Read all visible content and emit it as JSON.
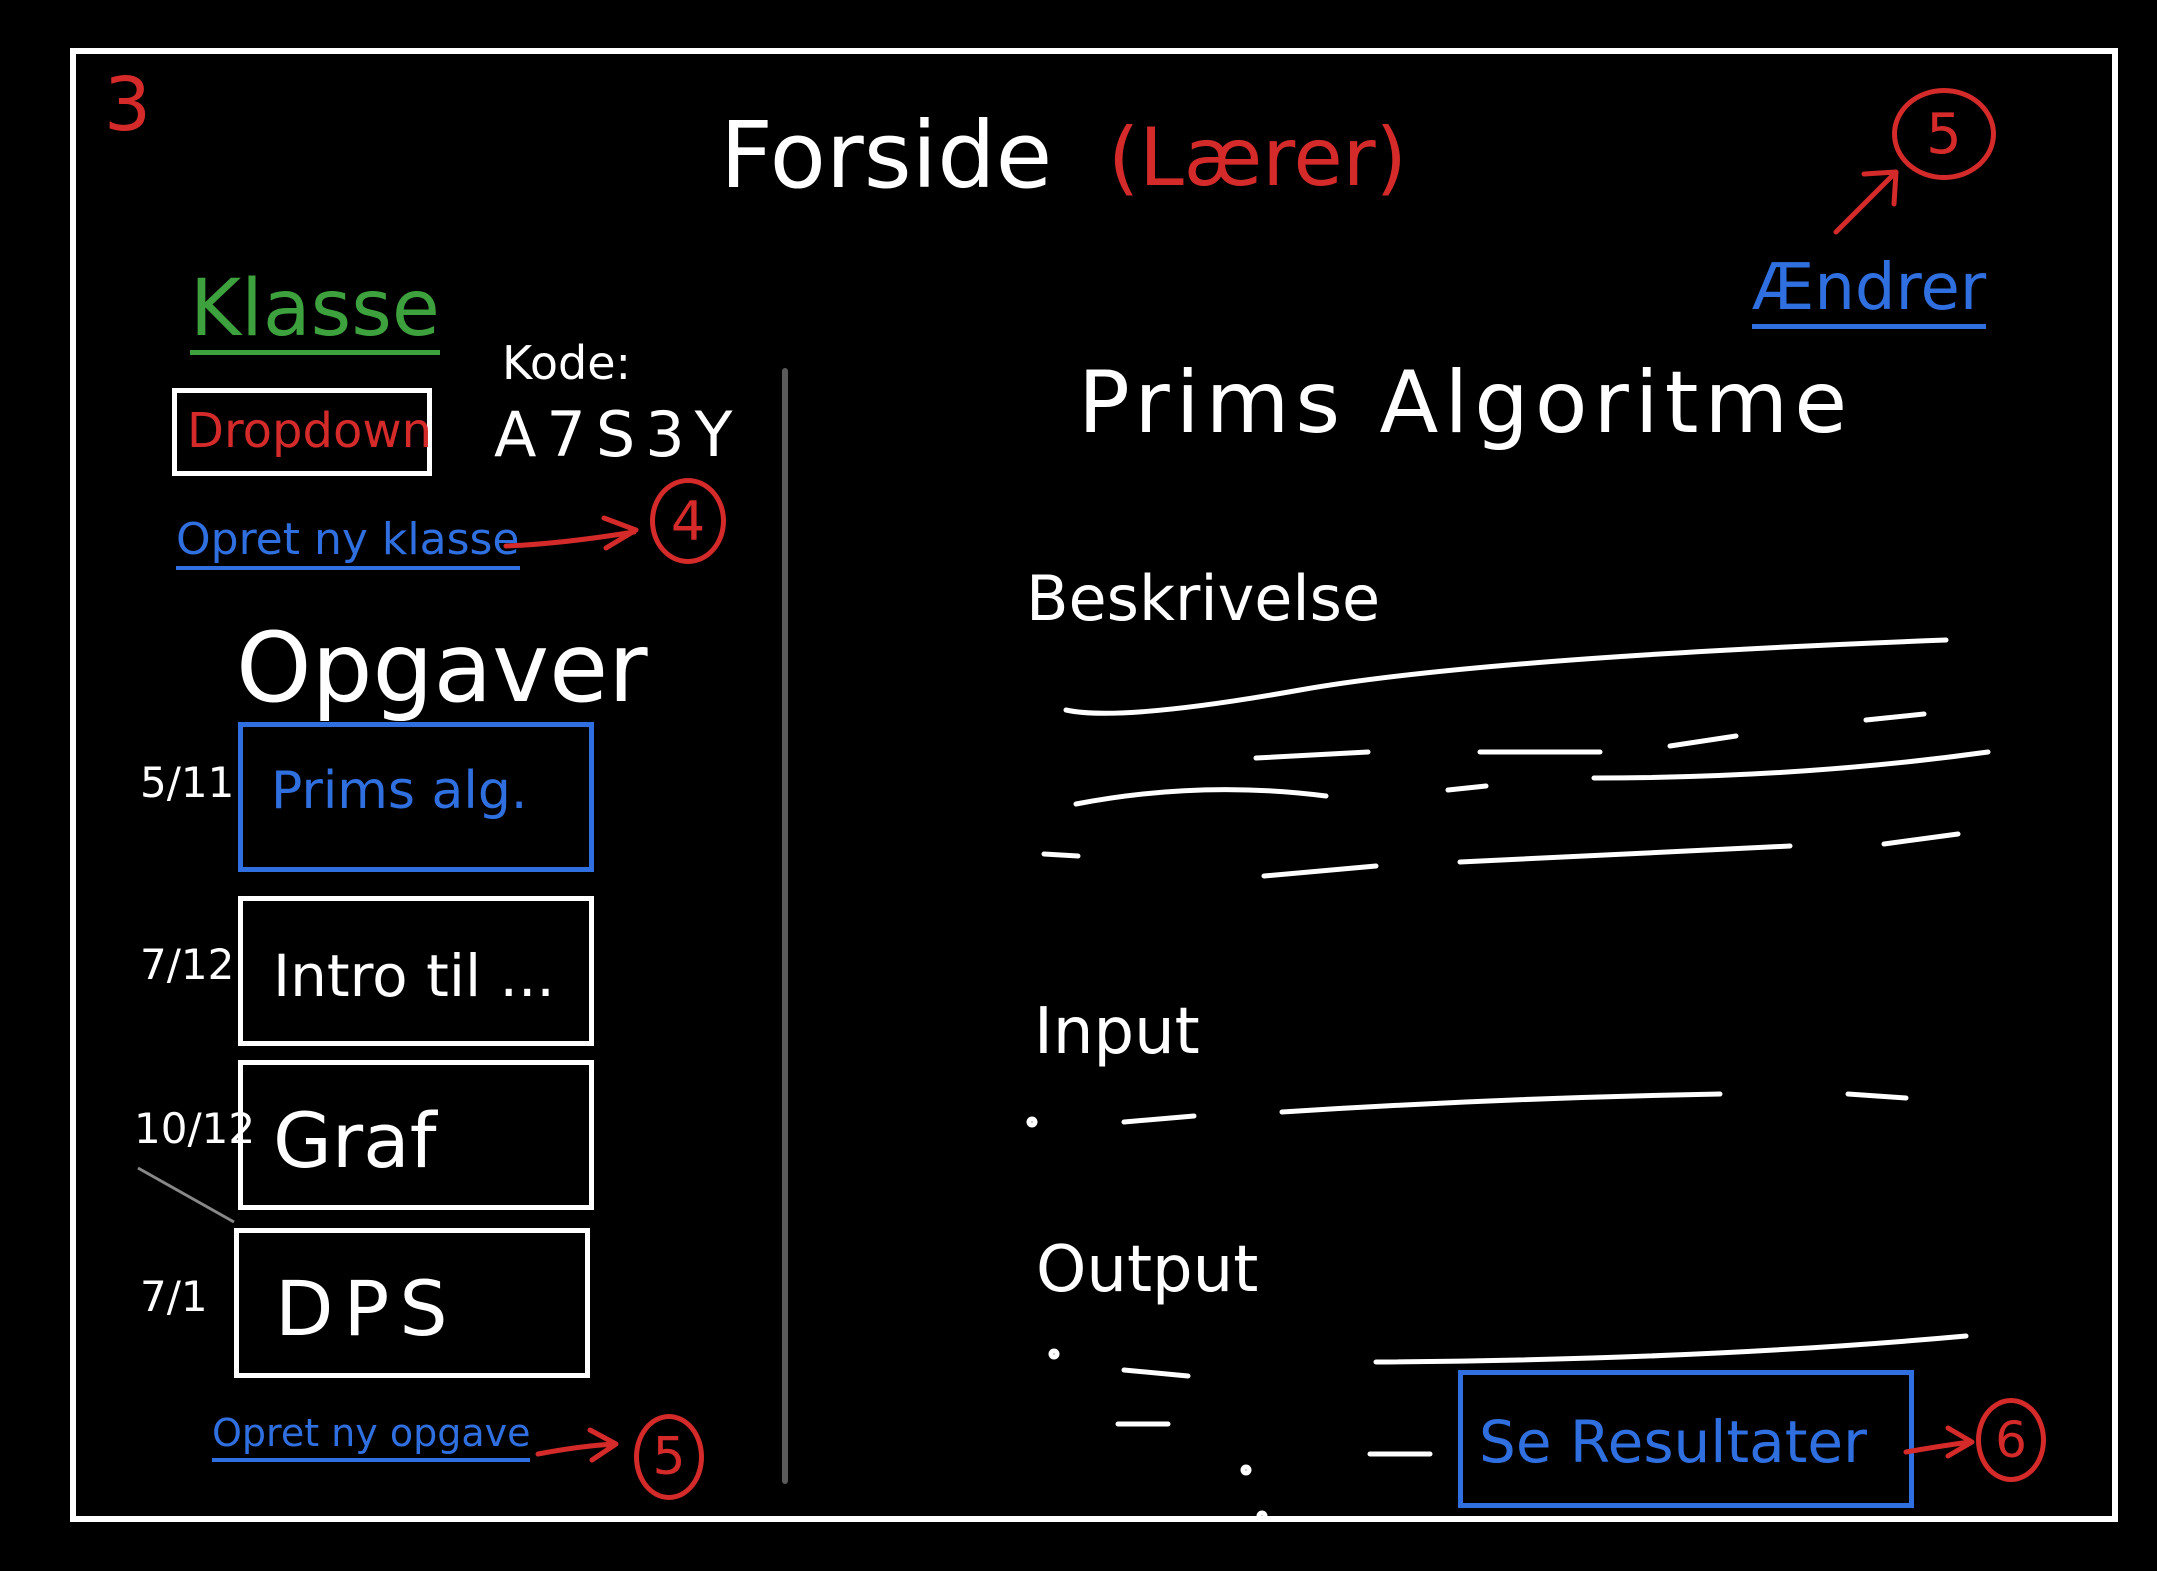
{
  "page_number": "3",
  "title": {
    "main": "Forside",
    "role": "(Lærer)"
  },
  "badges": {
    "edit": "5",
    "new_class": "4",
    "new_task": "5",
    "results": "6"
  },
  "left": {
    "class_label": "Klasse",
    "dropdown": "Dropdown",
    "code_label": "Kode:",
    "code_value": "A7S3Y",
    "new_class_link": "Opret ny klasse",
    "tasks_heading": "Opgaver",
    "tasks": [
      {
        "date": "5/11",
        "title": "Prims alg."
      },
      {
        "date": "7/12",
        "title": "Intro til ..."
      },
      {
        "date": "10/12",
        "title": "Graf"
      },
      {
        "date": "7/1",
        "title": "DPS"
      }
    ],
    "new_task_link": "Opret ny opgave"
  },
  "right": {
    "edit_link": "Ændrer",
    "task_title": "Prims Algoritme",
    "sections": {
      "description": "Beskrivelse",
      "input": "Input",
      "output": "Output"
    },
    "results_button": "Se Resultater"
  },
  "colors": {
    "red": "#d42a2a",
    "blue": "#2f6fe0",
    "green": "#3da23d",
    "white": "#ffffff"
  }
}
